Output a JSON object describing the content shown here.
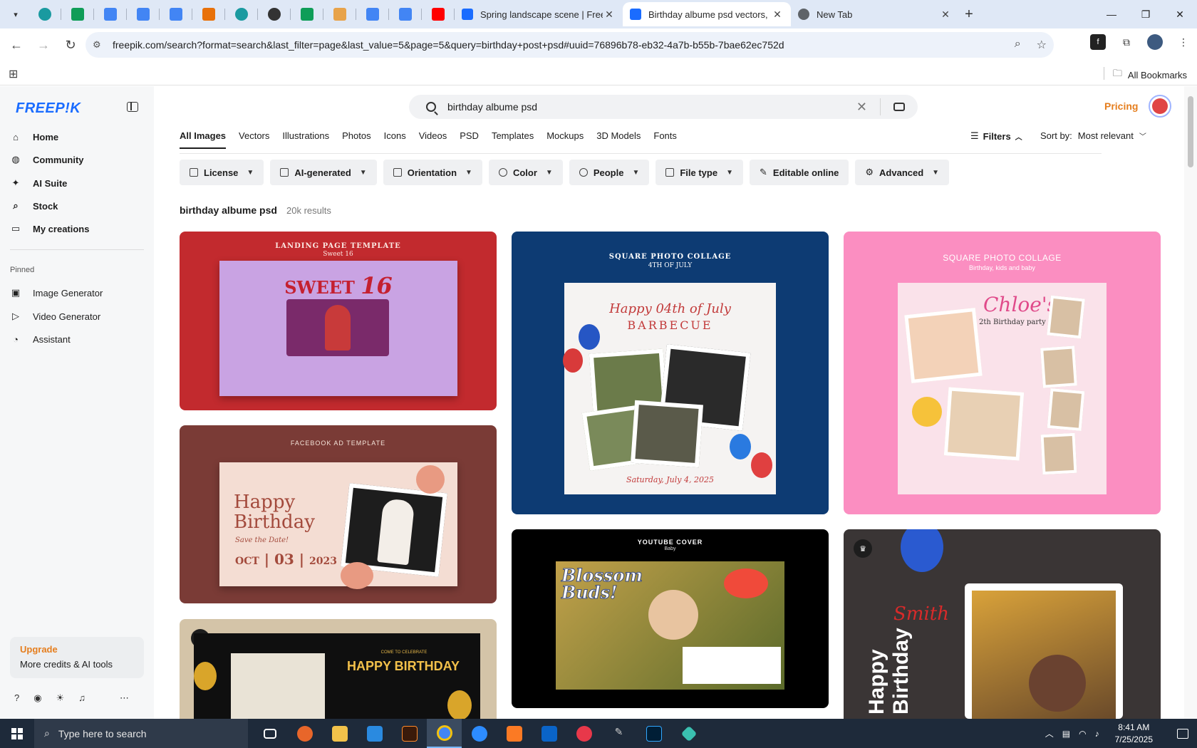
{
  "browser": {
    "tabs": [
      {
        "title": "Spring landscape scene | Free V",
        "favicon_color": "#1a6cff",
        "active": false
      },
      {
        "title": "Birthday albume psd vectors, pl",
        "favicon_color": "#1a6cff",
        "active": true
      },
      {
        "title": "New Tab",
        "favicon_color": "#5f6368",
        "active": false
      }
    ],
    "pinned_tab_colors": [
      "#0f9d58",
      "#0f9d58",
      "#4285f4",
      "#4285f4",
      "#4285f4",
      "#e8710a",
      "#1a9aa0",
      "#333333",
      "#0f9d58",
      "#e8a34a",
      "#4285f4",
      "#4285f4",
      "#ff0000"
    ],
    "url": "freepik.com/search?format=search&last_filter=page&last_value=5&page=5&query=birthday+post+psd#uuid=76896b78-eb32-4a7b-b55b-7bae62ec752d",
    "all_bookmarks": "All Bookmarks"
  },
  "sidebar": {
    "logo": "FREEP!K",
    "nav": [
      {
        "label": "Home",
        "icon": "home-icon"
      },
      {
        "label": "Community",
        "icon": "globe-icon"
      },
      {
        "label": "AI Suite",
        "icon": "sparkle-icon"
      },
      {
        "label": "Stock",
        "icon": "search-icon"
      },
      {
        "label": "My creations",
        "icon": "folder-icon"
      }
    ],
    "pinned_label": "Pinned",
    "pinned": [
      {
        "label": "Image Generator",
        "icon": "image-icon"
      },
      {
        "label": "Video Generator",
        "icon": "video-icon"
      },
      {
        "label": "Assistant",
        "icon": "chat-icon"
      }
    ],
    "upgrade": {
      "title": "Upgrade",
      "subtitle": "More credits & AI tools"
    }
  },
  "header": {
    "search_value": "birthday albume psd",
    "pricing": "Pricing"
  },
  "categories": [
    "All Images",
    "Vectors",
    "Illustrations",
    "Photos",
    "Icons",
    "Videos",
    "PSD",
    "Templates",
    "Mockups",
    "3D Models",
    "Fonts"
  ],
  "filters_label": "Filters",
  "sort": {
    "label": "Sort by:",
    "value": "Most relevant"
  },
  "chips": [
    "License",
    "AI-generated",
    "Orientation",
    "Color",
    "People",
    "File type",
    "Editable online",
    "Advanced"
  ],
  "results": {
    "query": "birthday albume psd",
    "count": "20k results"
  },
  "cards": {
    "c1": {
      "label": "LANDING PAGE TEMPLATE",
      "sub": "Sweet 16",
      "headline": "SWEET",
      "num": "16",
      "bg": "#c22a2e"
    },
    "c2": {
      "label": "FACEBOOK AD TEMPLATE",
      "headline1": "Happy",
      "headline2": "Birthday",
      "save": "Save the Date!",
      "date_m": "OCT",
      "date_d": "03",
      "date_y": "2023",
      "bg": "#7a3b36"
    },
    "c3": {
      "label": "COME TO CELEBRATE",
      "headline": "HAPPY BIRTHDAY",
      "bg": "#d4c4a8"
    },
    "c4": {
      "label": "SQUARE PHOTO COLLAGE",
      "sub": "4TH OF JULY",
      "headline1": "Happy 04th of July",
      "headline2": "BARBECUE",
      "footer": "Saturday, July 4, 2025",
      "bg": "#0d3b73"
    },
    "c5": {
      "label": "YOUTUBE COVER",
      "sub": "Baby",
      "headline": "Blossom Buds!",
      "bg": "#000000"
    },
    "c6": {
      "label": "SQUARE PHOTO COLLAGE",
      "sub": "Birthday, kids and baby",
      "headline": "Chloe's",
      "sub2": "2th Birthday party",
      "bg": "#fb8ec1"
    },
    "c7": {
      "headline": "Happy Birthday",
      "script": "Smith",
      "bg": "#3a3535"
    }
  },
  "taskbar": {
    "search_placeholder": "Type here to search",
    "time": "8:41 AM",
    "date": "7/25/2025"
  }
}
